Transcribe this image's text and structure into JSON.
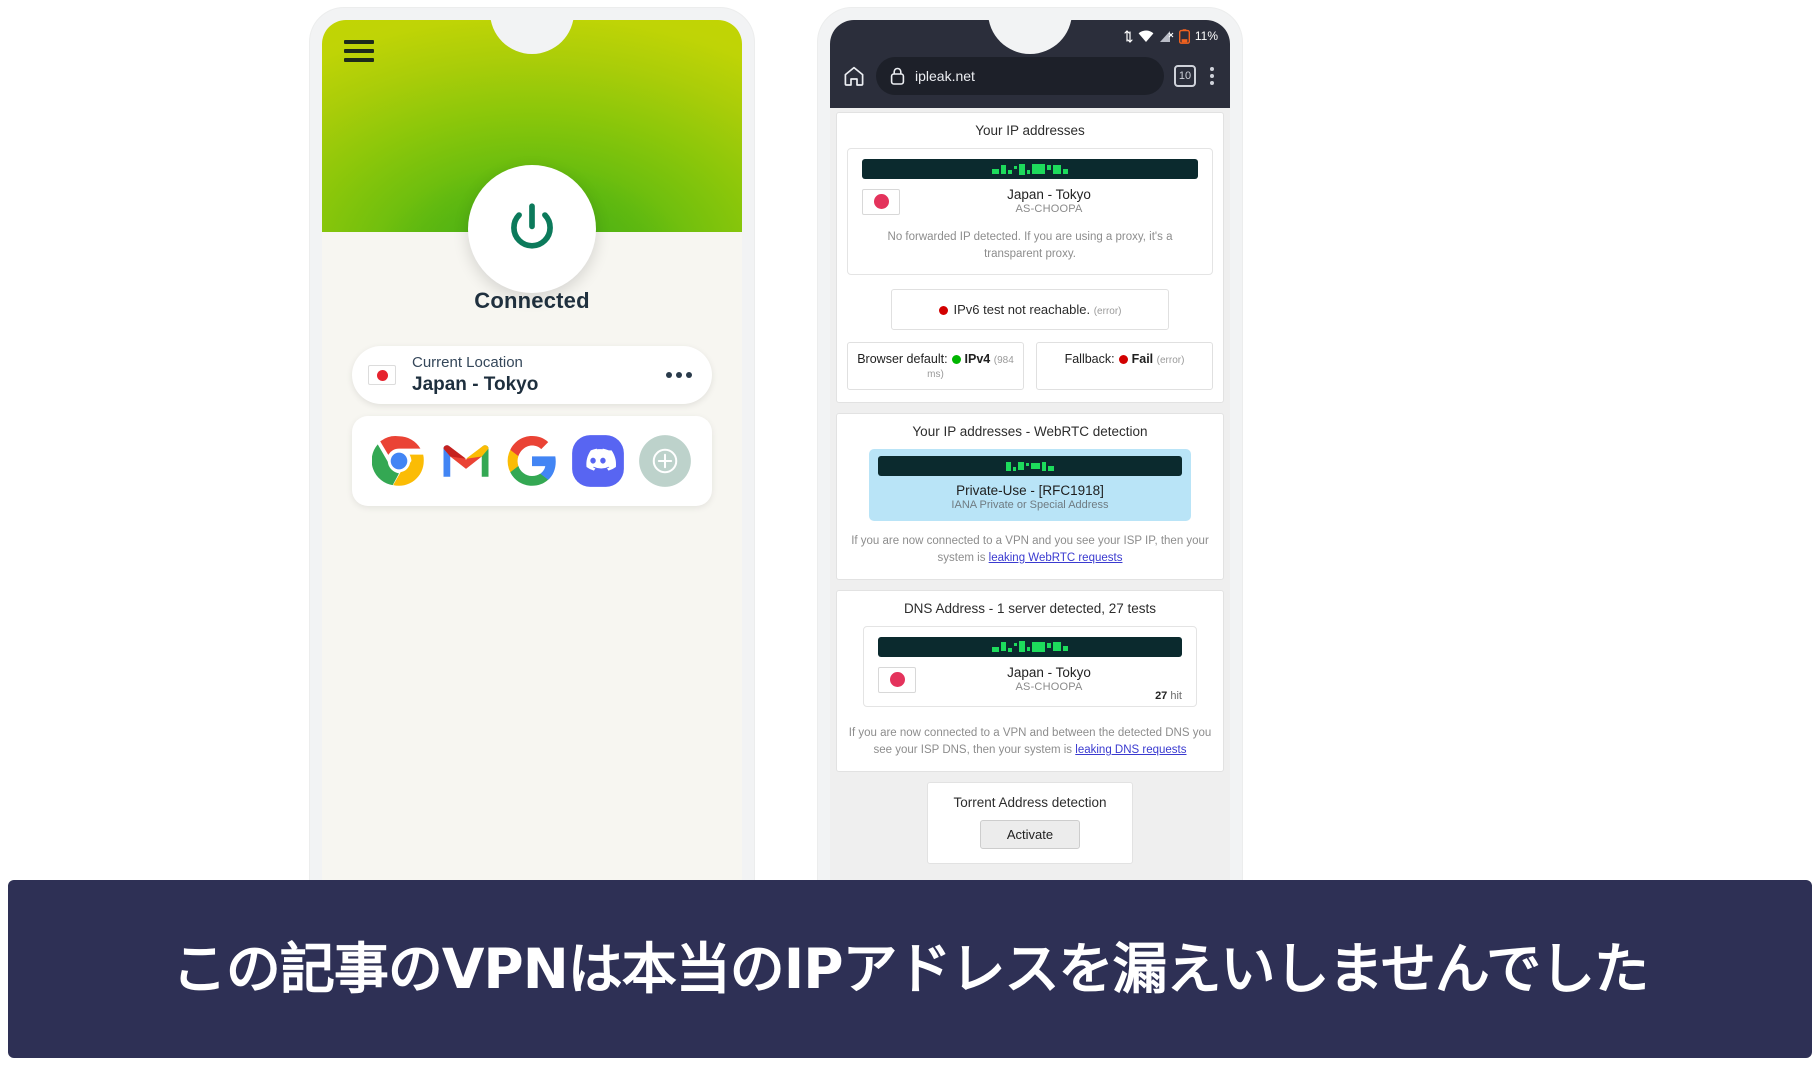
{
  "caption": {
    "text": "この記事のVPNは本当のIPアドレスを漏えいしませんでした"
  },
  "vpn_app": {
    "menu_icon": "hamburger-menu-icon",
    "power_icon": "power-icon",
    "status": "Connected",
    "location_card": {
      "label": "Current Location",
      "value": "Japan - Tokyo",
      "flag": "jp-flag-icon",
      "more_icon": "ellipsis-icon"
    },
    "apps": [
      {
        "name": "chrome-app-icon",
        "label": "Chrome"
      },
      {
        "name": "gmail-app-icon",
        "label": "Gmail"
      },
      {
        "name": "google-app-icon",
        "label": "Google"
      },
      {
        "name": "discord-app-icon",
        "label": "Discord"
      },
      {
        "name": "add-app-icon",
        "label": "Add"
      }
    ]
  },
  "browser": {
    "statusbar": {
      "battery": "11%",
      "icons": [
        "data-transfer-icon",
        "wifi-icon",
        "cell-signal-off-icon",
        "battery-low-icon"
      ]
    },
    "toolbar": {
      "home_icon": "home-icon",
      "lock_icon": "lock-icon",
      "url": "ipleak.net",
      "tab_count": "10",
      "menu_icon": "kebab-menu-icon"
    },
    "sections": {
      "ip": {
        "title": "Your IP addresses",
        "ip_masked": "",
        "country": "Japan - Tokyo",
        "asn": "AS-CHOOPA",
        "note": "No forwarded IP detected. If you are using a proxy, it's a transparent proxy.",
        "ipv6": {
          "text": "IPv6 test not reachable.",
          "tag": "(error)",
          "status_color": "#d20000"
        },
        "browser_default": {
          "label": "Browser default:",
          "value": "IPv4",
          "timing": "(984 ms)",
          "status_color": "#00b500"
        },
        "fallback": {
          "label": "Fallback:",
          "value": "Fail",
          "tag": "(error)",
          "status_color": "#d20000"
        }
      },
      "webrtc": {
        "title": "Your IP addresses - WebRTC detection",
        "ip_masked": "",
        "label": "Private-Use - [RFC1918]",
        "sublabel": "IANA Private or Special Address",
        "note_prefix": "If you are now connected to a VPN and you see your ISP IP, then your system is ",
        "note_link": "leaking WebRTC requests"
      },
      "dns": {
        "title": "DNS Address - 1 server detected, 27 tests",
        "ip_masked": "",
        "country": "Japan - Tokyo",
        "asn": "AS-CHOOPA",
        "hit_count": "27",
        "hit_label": "hit",
        "note_prefix": "If you are now connected to a VPN and between the detected DNS you see your ISP DNS, then your system is ",
        "note_link": "leaking DNS requests"
      },
      "torrent": {
        "title": "Torrent Address detection",
        "button": "Activate"
      }
    }
  },
  "colors": {
    "vpn_green_deep": "#2e9d1c",
    "vpn_green_lime": "#c6d400",
    "caption_bg": "#2e3055",
    "link": "#3a3ad0",
    "ip_bar_bg": "#0b2a2e",
    "ip_text": "#1ddb5c",
    "webrtc_bg": "#b9e4f7"
  }
}
